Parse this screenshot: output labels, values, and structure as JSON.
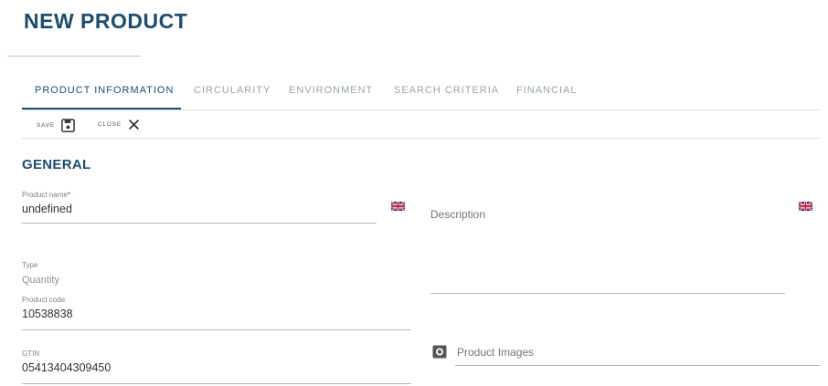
{
  "page": {
    "title": "NEW PRODUCT"
  },
  "tabs": [
    {
      "label": "PRODUCT INFORMATION",
      "active": true
    },
    {
      "label": "CIRCULARITY",
      "active": false
    },
    {
      "label": "ENVIRONMENT",
      "active": false
    },
    {
      "label": "SEARCH CRITERIA",
      "active": false
    },
    {
      "label": "FINANCIAL",
      "active": false
    }
  ],
  "toolbar": {
    "save_label": "SAVE",
    "close_label": "CLOSE"
  },
  "section": {
    "title": "GENERAL"
  },
  "form": {
    "product_name": {
      "label": "Product name",
      "required_marker": "*",
      "value": "undefined"
    },
    "description": {
      "label": "Description"
    },
    "type": {
      "label": "Type",
      "value": "Quantity"
    },
    "product_code": {
      "label": "Product code",
      "value": "10538838"
    },
    "gtin": {
      "label": "GTIN",
      "value": "05413404309450"
    },
    "product_images": {
      "label": "Product Images"
    }
  },
  "icons": {
    "save": "floppy-disk-icon",
    "close": "close-x-icon",
    "flag": "uk-flag-icon",
    "camera": "camera-icon"
  },
  "colors": {
    "accent": "#1c4d6e",
    "divider": "#d8e2e8",
    "required": "#c0392b"
  }
}
